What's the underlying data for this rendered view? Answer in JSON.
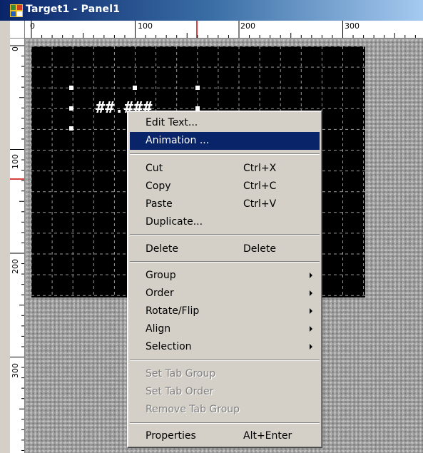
{
  "window": {
    "title": "Target1 - Panel1"
  },
  "ruler": {
    "h_labels": [
      "0",
      "100",
      "200",
      "300"
    ],
    "v_labels": [
      "0",
      "100",
      "200",
      "300"
    ]
  },
  "panel": {
    "text": "##.###"
  },
  "context_menu": {
    "items": [
      {
        "label": "Edit Text...",
        "shortcut": ""
      },
      {
        "label": "Animation ...",
        "shortcut": "",
        "selected": true
      },
      {
        "label": "Cut",
        "shortcut": "Ctrl+X"
      },
      {
        "label": "Copy",
        "shortcut": "Ctrl+C"
      },
      {
        "label": "Paste",
        "shortcut": "Ctrl+V"
      },
      {
        "label": "Duplicate...",
        "shortcut": ""
      },
      {
        "label": "Delete",
        "shortcut": "Delete"
      },
      {
        "label": "Group",
        "submenu": true
      },
      {
        "label": "Order",
        "submenu": true
      },
      {
        "label": "Rotate/Flip",
        "submenu": true
      },
      {
        "label": "Align",
        "submenu": true
      },
      {
        "label": "Selection",
        "submenu": true
      },
      {
        "label": "Set Tab Group",
        "disabled": true
      },
      {
        "label": "Set Tab Order",
        "disabled": true
      },
      {
        "label": "Remove Tab Group",
        "disabled": true
      },
      {
        "label": "Properties",
        "shortcut": "Alt+Enter"
      }
    ]
  },
  "colors": {
    "selection": "#0a246a",
    "panel_bg": "#000000",
    "menu_bg": "#d4d0c8",
    "ruler_marker": "#cc0000"
  }
}
